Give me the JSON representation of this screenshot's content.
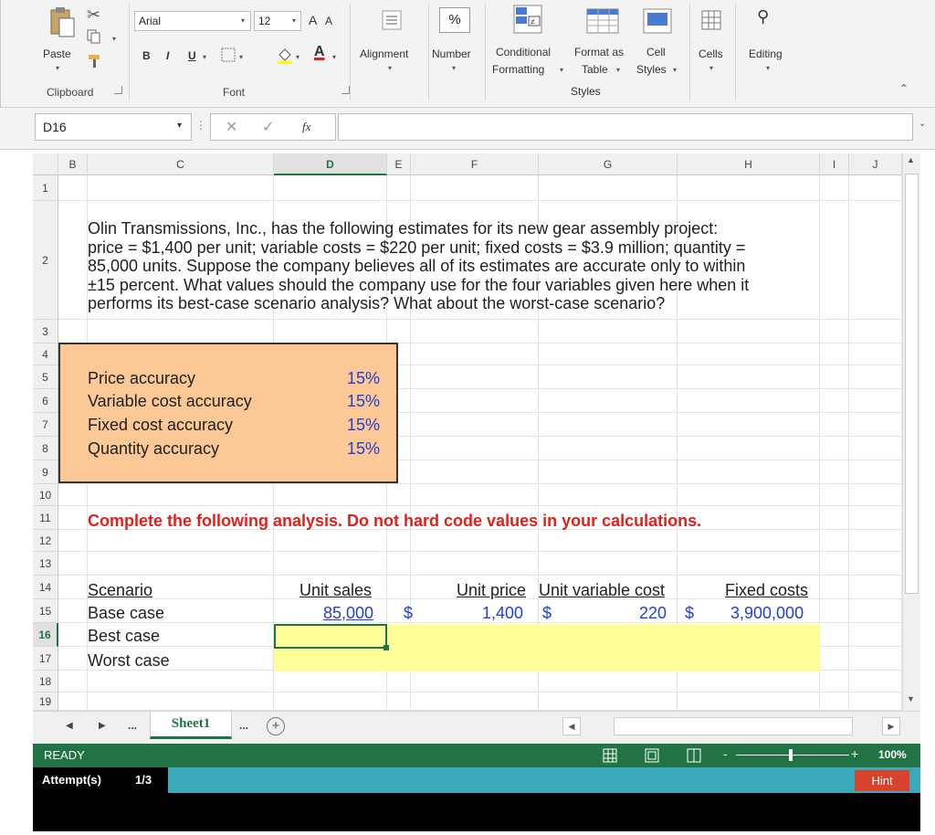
{
  "ribbon": {
    "clipboard": {
      "paste": "Paste",
      "group": "Clipboard"
    },
    "font": {
      "name": "Arial",
      "size": "12",
      "bold": "B",
      "italic": "I",
      "underline": "U",
      "grow": "A",
      "shrink": "A",
      "group": "Font"
    },
    "alignment": {
      "label": "Alignment"
    },
    "number": {
      "label": "Number",
      "symbol": "%"
    },
    "styles": {
      "conditional_1": "Conditional",
      "conditional_2": "Formatting",
      "format_table_1": "Format as",
      "format_table_2": "Table",
      "cell_styles_1": "Cell",
      "cell_styles_2": "Styles",
      "group": "Styles"
    },
    "cells": {
      "label": "Cells"
    },
    "editing": {
      "label": "Editing"
    }
  },
  "formula_bar": {
    "name_box": "D16",
    "fx": "fx",
    "content": ""
  },
  "columns": [
    "B",
    "C",
    "D",
    "E",
    "F",
    "G",
    "H",
    "I",
    "J"
  ],
  "rows": [
    "1",
    "2",
    "3",
    "4",
    "5",
    "6",
    "7",
    "8",
    "9",
    "10",
    "11",
    "12",
    "13",
    "14",
    "15",
    "16",
    "17",
    "18",
    "19"
  ],
  "problem": {
    "lines": [
      "Olin Transmissions, Inc., has the following estimates for its new gear assembly project:",
      "price = $1,400 per unit; variable costs = $220 per unit; fixed costs = $3.9 million; quantity =",
      "85,000 units. Suppose the company believes all of its estimates are accurate only to within",
      "±15 percent. What values should the company use for the four variables given here when it",
      "performs its best-case scenario analysis? What about the worst-case scenario?"
    ]
  },
  "inputs": [
    {
      "label": "Price accuracy",
      "value": "15%"
    },
    {
      "label": "Variable cost accuracy",
      "value": "15%"
    },
    {
      "label": "Fixed cost accuracy",
      "value": "15%"
    },
    {
      "label": "Quantity accuracy",
      "value": "15%"
    }
  ],
  "instruction": "Complete the following analysis. Do not hard code values in your calculations.",
  "table": {
    "headers": {
      "scenario": "Scenario",
      "unit_sales": "Unit sales",
      "unit_price": "Unit price",
      "unit_variable_cost": "Unit variable cost",
      "fixed_costs": "Fixed costs"
    },
    "base": {
      "label": "Base case",
      "unit_sales": "85,000",
      "dollar": "$",
      "unit_price": "1,400",
      "unit_variable_cost": "220",
      "fixed_costs": "3,900,000"
    },
    "best": {
      "label": "Best case"
    },
    "worst": {
      "label": "Worst case"
    }
  },
  "sheet": {
    "tab": "Sheet1",
    "more": "...",
    "add": "+"
  },
  "status": {
    "ready": "READY",
    "zoom": "100%"
  },
  "attempts": {
    "label": "Attempt(s)",
    "value": "1/3",
    "hint": "Hint"
  },
  "colors": {
    "accent_green": "#217346",
    "input_fill": "#fbc896",
    "yellow_fill": "#ffff99",
    "blue_text": "#1f3fd6",
    "red_text": "#e0201b"
  }
}
